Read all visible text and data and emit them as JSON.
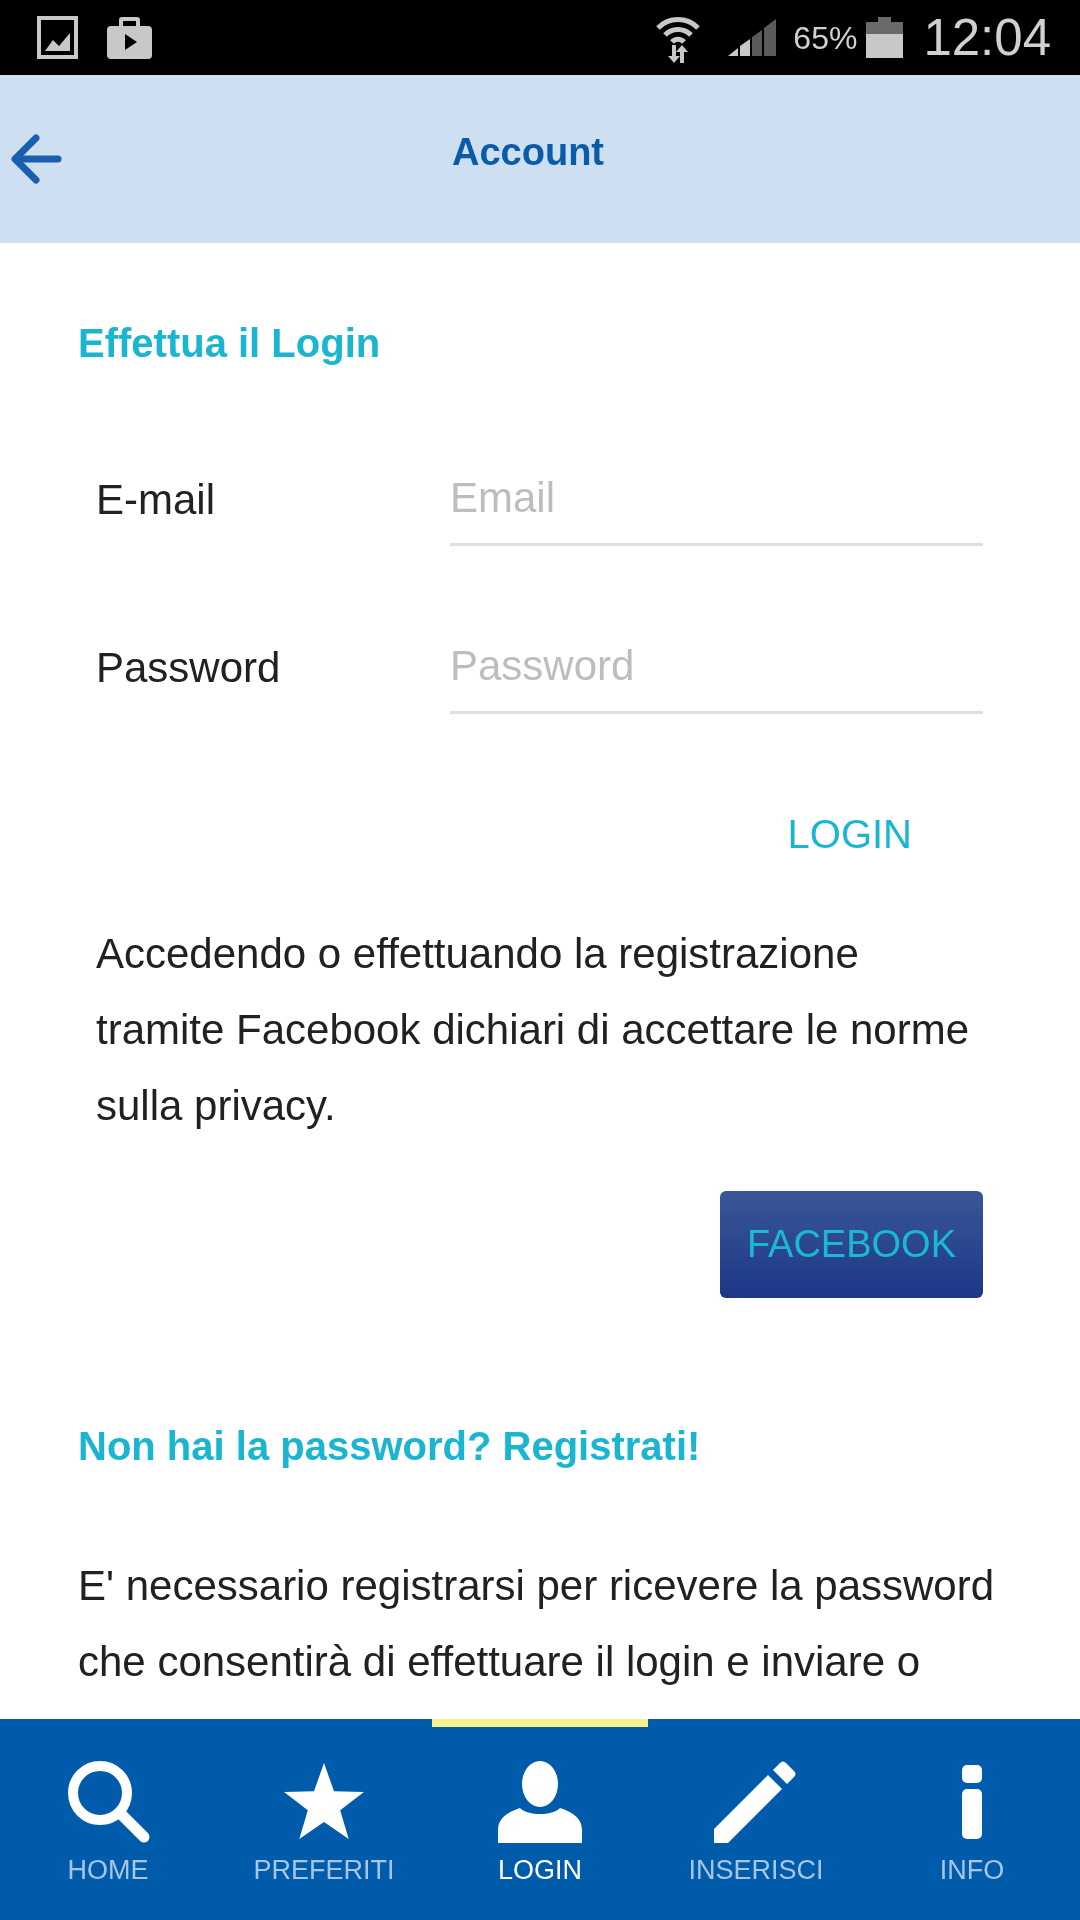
{
  "status_bar": {
    "battery": "65%",
    "time": "12:04"
  },
  "header": {
    "title": "Account"
  },
  "login": {
    "heading": "Effettua il Login",
    "fields": [
      {
        "label": "E-mail",
        "placeholder": "Email"
      },
      {
        "label": "Password",
        "placeholder": "Password"
      }
    ],
    "login_button": "LOGIN",
    "notice": "Accedendo o effettuando la registrazione tramite Facebook dichiari di accettare le norme sulla privacy.",
    "facebook_button": "FACEBOOK"
  },
  "register": {
    "heading": "Non hai la password? Registrati!",
    "text": "E' necessario registrarsi per ricevere la password che consentirà di effettuare il login e inviare o"
  },
  "bottom_nav": [
    {
      "label": "HOME",
      "selected": false
    },
    {
      "label": "PREFERITI",
      "selected": false
    },
    {
      "label": "LOGIN",
      "selected": true
    },
    {
      "label": "INSERISCI",
      "selected": false
    },
    {
      "label": "INFO",
      "selected": false
    }
  ]
}
